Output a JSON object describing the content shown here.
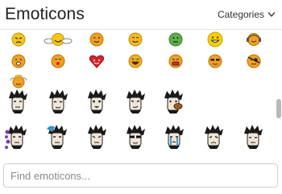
{
  "header": {
    "title": "Emoticons",
    "categories_label": "Categories",
    "categories_icon": "chevron-down-icon"
  },
  "search": {
    "placeholder": "Find emoticons..."
  },
  "emoticon_rows": [
    [
      "angry-smiley",
      "thumbs-up-smiley",
      "wink-smiley",
      "blush-smiley",
      "green-sick-smiley",
      "grin-smiley",
      "headphones-smiley"
    ],
    [
      "crying-smiley",
      "kiss-smiley",
      "heart-smiley",
      "laughing-smiley",
      "red-mouth-smiley",
      "cool-smiley",
      "pirate-smiley"
    ],
    [
      "angel-smiley"
    ],
    [
      "wilson-neutral",
      "wilson-calm",
      "wilson-wide",
      "wilson-smirk",
      "wilson-eating"
    ],
    [
      "wilson-purple",
      "wilson-blue",
      "wilson-sweat",
      "wilson-sunglasses",
      "wilson-crying",
      "wilson-sad",
      "wilson-sleepy"
    ]
  ],
  "colors": {
    "smiley_yellow": "#f5c518",
    "smiley_orange": "#f0a020",
    "heart_red": "#d9232e",
    "sick_green": "#4caf50",
    "scroll_thumb": "#b9b9b9"
  }
}
